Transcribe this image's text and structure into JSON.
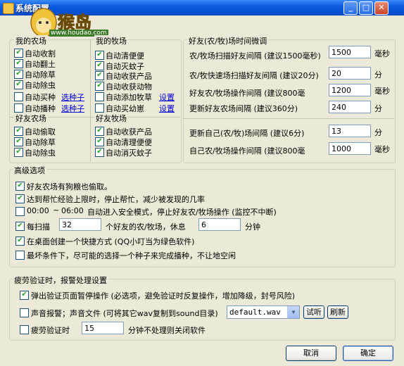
{
  "window": {
    "title": "系统配置",
    "logo_text": "猴岛",
    "logo_url": "www.houdao.com"
  },
  "titlebar_buttons": {
    "minimize": "_",
    "maximize": "□",
    "close": "✕"
  },
  "my_farm": {
    "title": "我的农场",
    "items": [
      {
        "label": "自动收割",
        "checked": true
      },
      {
        "label": "自动翻土",
        "checked": true
      },
      {
        "label": "自动除草",
        "checked": true
      },
      {
        "label": "自动除虫",
        "checked": true
      },
      {
        "label": "自动买种",
        "checked": false
      },
      {
        "label": "自动播种",
        "checked": false
      }
    ],
    "select_seed_link": "选种子"
  },
  "my_ranch": {
    "title": "我的牧场",
    "items": [
      {
        "label": "自动清便便",
        "checked": true
      },
      {
        "label": "自动灭蚊子",
        "checked": true
      },
      {
        "label": "自动收获产品",
        "checked": true
      },
      {
        "label": "自动收获动物",
        "checked": true
      },
      {
        "label": "自动添加牧草",
        "checked": false
      },
      {
        "label": "自动买幼崽",
        "checked": false
      }
    ],
    "setup_link": "设置"
  },
  "friend_farm": {
    "title": "好友农场",
    "items": [
      {
        "label": "自动偷取",
        "checked": true
      },
      {
        "label": "自动除草",
        "checked": true
      },
      {
        "label": "自动除虫",
        "checked": true
      }
    ]
  },
  "friend_ranch": {
    "title": "好友牧场",
    "items": [
      {
        "label": "自动收获产品",
        "checked": true
      },
      {
        "label": "自动清理便便",
        "checked": true
      },
      {
        "label": "自动消灭蚊子",
        "checked": true
      }
    ]
  },
  "timing": {
    "title": "好友(农/牧)场时间微调",
    "rows": [
      {
        "label": "农/牧场扫描好友间隔 (建议1500毫秒)",
        "value": "1500",
        "unit": "毫秒"
      },
      {
        "label": "农/牧快速场扫描好友间隔 (建议20分)",
        "value": "20",
        "unit": "分"
      },
      {
        "label": "好友农/牧场操作间隔 (建议800毫",
        "value": "1200",
        "unit": "毫秒"
      },
      {
        "label": "更新好友农场间隔 (建议360分)",
        "value": "240",
        "unit": "分"
      },
      {
        "label": "更新自己(农/牧)场间隔 (建议6分)",
        "value": "13",
        "unit": "分"
      },
      {
        "label": "自己农/牧场操作间隔 (建议800毫",
        "value": "1000",
        "unit": "毫秒"
      }
    ]
  },
  "advanced": {
    "title": "高级选项",
    "dog_steal": {
      "label": "好友农场有狗粮也偷取。",
      "checked": true
    },
    "help_limit": {
      "label": "达到帮忙经验上限时，停止帮忙，减少被发现的几率",
      "checked": true
    },
    "safe_mode": {
      "from": "00:00",
      "sep": "~",
      "to": "06:00",
      "label": "自动进入安全模式，停止好友农/牧场操作 (监控不中断)",
      "checked": false
    },
    "scan": {
      "prefix": "每扫描",
      "count": "32",
      "middle": "个好友的农/牧场，休息",
      "rest": "6",
      "unit": "分钟",
      "checked": true
    },
    "shortcut": {
      "label": "在桌面创建一个快捷方式 (QQ小叮当为绿色软件)",
      "checked": true
    },
    "worst_case": {
      "label": "最坏条件下，尽可能的选择一个种子来完成播种，不让地空闲",
      "checked": false
    }
  },
  "fatigue": {
    "title": "疲劳验证时，报警处理设置",
    "popup": {
      "label": "弹出验证页面暂停操作 (必选项，避免验证时反复操作，增加降级，封号风险)",
      "checked": true
    },
    "sound": {
      "label": "声音报警；声音文件 (可将其它wav复制到sound目录)",
      "file": "default.wav",
      "test": "试听",
      "refresh": "刷新",
      "checked": false
    },
    "timeout": {
      "label": "疲劳验证时",
      "value": "15",
      "suffix": "分钟不处理则关闭软件",
      "checked": false
    }
  },
  "buttons": {
    "cancel": "取消",
    "ok": "确定"
  }
}
